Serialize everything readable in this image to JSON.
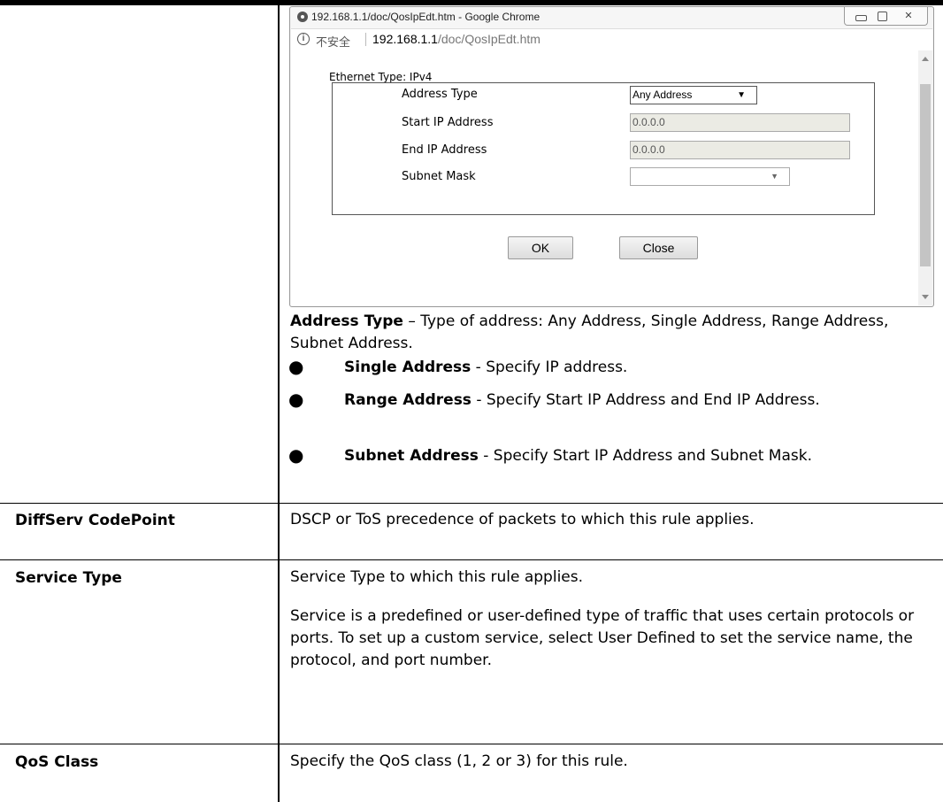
{
  "popup": {
    "window_title": "192.168.1.1/doc/QosIpEdt.htm - Google Chrome",
    "insecure_label": "不安全",
    "url_host": "192.168.1.1",
    "url_path": "/doc/QosIpEdt.htm",
    "ethernet_type": "Ethernet Type: IPv4",
    "fields": {
      "address_type": {
        "label": "Address Type",
        "value": "Any Address"
      },
      "start_ip": {
        "label": "Start IP Address",
        "value": "0.0.0.0"
      },
      "end_ip": {
        "label": "End IP Address",
        "value": "0.0.0.0"
      },
      "subnet_mask": {
        "label": "Subnet Mask",
        "value": ""
      }
    },
    "ok_label": "OK",
    "close_label": "Close"
  },
  "address_type_desc": {
    "term": "Address Type",
    "text": " – Type of address: Any Address, Single Address, Range Address, Subnet Address."
  },
  "bullets": [
    {
      "term": "Single Address",
      "text": " - Specify IP address."
    },
    {
      "term": "Range Address",
      "text": " - Specify Start IP Address and End IP Address."
    },
    {
      "term": "Subnet Address",
      "text": " - Specify Start IP Address and Subnet Mask."
    }
  ],
  "rows": [
    {
      "term": "DiffServ CodePoint",
      "desc": "DSCP or ToS precedence of packets to which this rule applies."
    },
    {
      "term": "Service Type",
      "desc": "Service Type to which this rule applies.",
      "desc2": "Service is a predefined or user-defined type of traffic that uses certain protocols or ports. To set up a custom service, select User Defined to set the service name, the protocol, and port number."
    },
    {
      "term": "QoS Class",
      "desc": "Specify the QoS class (1, 2 or 3) for this rule."
    }
  ]
}
